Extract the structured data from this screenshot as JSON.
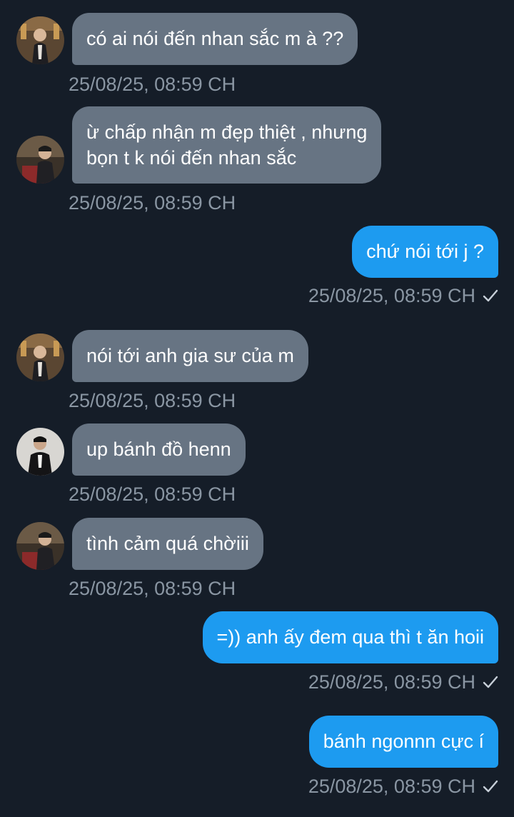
{
  "messages": [
    {
      "side": "in",
      "lines": [
        "có ai nói đến nhan sắc m à ??"
      ],
      "time": "25/08/25, 08:59 CH",
      "avatar": "avatar-1"
    },
    {
      "side": "in",
      "lines": [
        "ừ chấp nhận m đẹp thiệt , nhưng",
        "bọn t k nói đến nhan sắc"
      ],
      "time": "25/08/25, 08:59 CH",
      "avatar": "avatar-2"
    },
    {
      "side": "out",
      "lines": [
        "chứ nói tới j ?"
      ],
      "time": "25/08/25, 08:59 CH",
      "status_icon": "check-icon"
    },
    {
      "side": "in",
      "lines": [
        "nói tới anh gia sư của m"
      ],
      "time": "25/08/25, 08:59 CH",
      "avatar": "avatar-1"
    },
    {
      "side": "in",
      "lines": [
        "up bánh đồ henn"
      ],
      "time": "25/08/25, 08:59 CH",
      "avatar": "avatar-3"
    },
    {
      "side": "in",
      "lines": [
        "tình cảm quá chờiii"
      ],
      "time": "25/08/25, 08:59 CH",
      "avatar": "avatar-2"
    },
    {
      "side": "out",
      "lines": [
        "=)) anh ấy đem qua thì t ăn hoii"
      ],
      "time": "25/08/25, 08:59 CH",
      "status_icon": "check-icon"
    },
    {
      "side": "out",
      "lines": [
        "bánh ngonnn cực í"
      ],
      "time": "25/08/25, 08:59 CH",
      "status_icon": "check-icon"
    }
  ],
  "colors": {
    "background": "#151d28",
    "incoming_bubble": "#677483",
    "outgoing_bubble": "#1d9bf0",
    "timestamp": "#8a96a3",
    "text": "#ffffff"
  }
}
